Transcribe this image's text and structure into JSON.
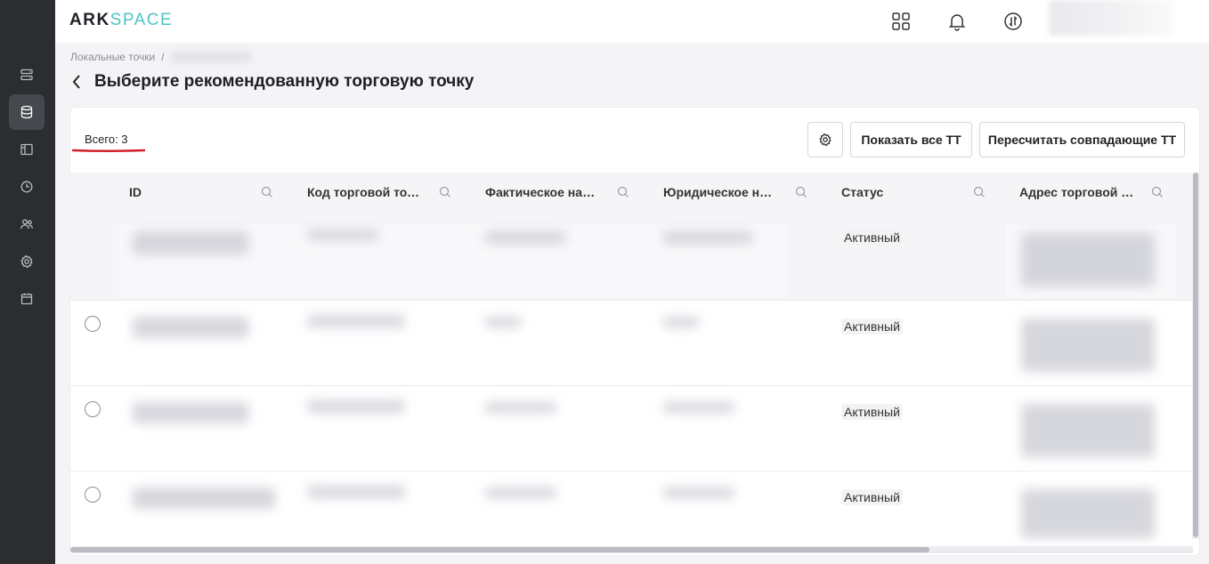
{
  "app": {
    "logo_part1": "ARK",
    "logo_part2": "SPACE"
  },
  "sidebar": {
    "items": [
      {
        "icon": "list-icon",
        "active": false
      },
      {
        "icon": "database-icon",
        "active": true
      },
      {
        "icon": "layout-icon",
        "active": false
      },
      {
        "icon": "clock-icon",
        "active": false
      },
      {
        "icon": "users-icon",
        "active": false
      },
      {
        "icon": "gear-icon",
        "active": false
      },
      {
        "icon": "calendar-icon",
        "active": false
      }
    ]
  },
  "header": {
    "icons": [
      "apps-grid-icon",
      "bell-icon",
      "sync-icon"
    ]
  },
  "breadcrumb": {
    "root": "Локальные точки",
    "separator": "/"
  },
  "page": {
    "title": "Выберите рекомендованную торговую точку"
  },
  "summary": {
    "total": "Всего: 3"
  },
  "toolbar": {
    "show_all_label": "Показать все ТТ",
    "recalc_label": "Пересчитать совпадающие ТТ"
  },
  "table": {
    "columns": [
      {
        "label": "ID"
      },
      {
        "label": "Код торговой точки"
      },
      {
        "label": "Фактическое название"
      },
      {
        "label": "Юридическое название"
      },
      {
        "label": "Статус"
      },
      {
        "label": "Адрес торговой точки"
      }
    ],
    "rows": [
      {
        "status": "Активный",
        "selectable": false
      },
      {
        "status": "Активный",
        "selectable": true
      },
      {
        "status": "Активный",
        "selectable": true
      },
      {
        "status": "Активный",
        "selectable": true
      }
    ]
  },
  "colors": {
    "accent": "#4fc3c6",
    "sidebar": "#2b2d31",
    "annotation": "#d0202a"
  }
}
